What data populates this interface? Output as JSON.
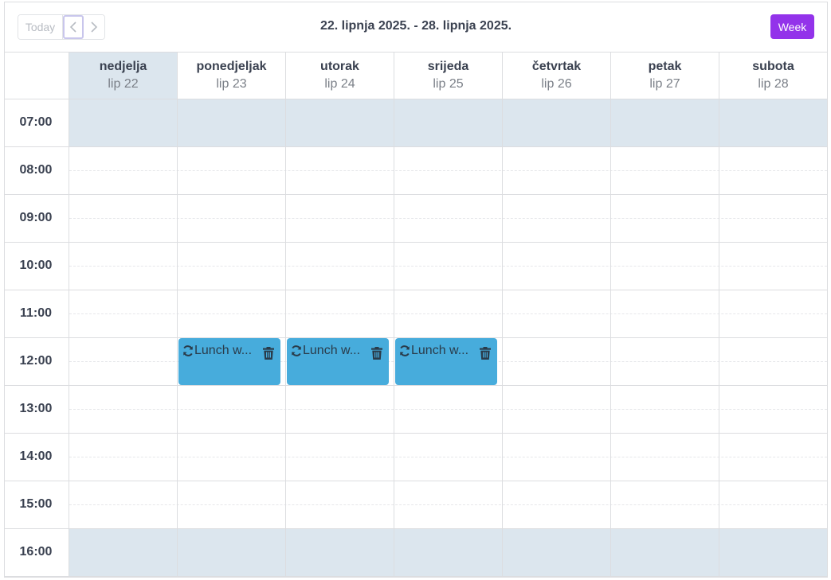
{
  "toolbar": {
    "today_label": "Today",
    "range_title": "22. lipnja 2025. - 28. lipnja 2025.",
    "view_label": "Week",
    "prev_icon": "chevron-left-icon",
    "next_icon": "chevron-right-icon"
  },
  "days": [
    {
      "name": "nedjelja",
      "date": "lip 22",
      "today": true
    },
    {
      "name": "ponedjeljak",
      "date": "lip 23",
      "today": false
    },
    {
      "name": "utorak",
      "date": "lip 24",
      "today": false
    },
    {
      "name": "srijeda",
      "date": "lip 25",
      "today": false
    },
    {
      "name": "četvrtak",
      "date": "lip 26",
      "today": false
    },
    {
      "name": "petak",
      "date": "lip 27",
      "today": false
    },
    {
      "name": "subota",
      "date": "lip 28",
      "today": false
    }
  ],
  "hours": [
    {
      "label": "07:00",
      "shaded": true
    },
    {
      "label": "08:00",
      "shaded": false
    },
    {
      "label": "09:00",
      "shaded": false
    },
    {
      "label": "10:00",
      "shaded": false
    },
    {
      "label": "11:00",
      "shaded": false
    },
    {
      "label": "12:00",
      "shaded": false
    },
    {
      "label": "13:00",
      "shaded": false
    },
    {
      "label": "14:00",
      "shaded": false
    },
    {
      "label": "15:00",
      "shaded": false
    },
    {
      "label": "16:00",
      "shaded": true
    }
  ],
  "events": [
    {
      "title": "Lunch w...",
      "day": 1,
      "hour": "12:00",
      "recurring": true,
      "icon": "repeat-icon",
      "action_icon": "trash-icon"
    },
    {
      "title": "Lunch w...",
      "day": 2,
      "hour": "12:00",
      "recurring": true,
      "icon": "repeat-icon",
      "action_icon": "trash-icon"
    },
    {
      "title": "Lunch w...",
      "day": 3,
      "hour": "12:00",
      "recurring": true,
      "icon": "repeat-icon",
      "action_icon": "trash-icon"
    }
  ],
  "colors": {
    "accent": "#9333ea",
    "event": "#47acdc",
    "shaded": "#dce6ee"
  }
}
